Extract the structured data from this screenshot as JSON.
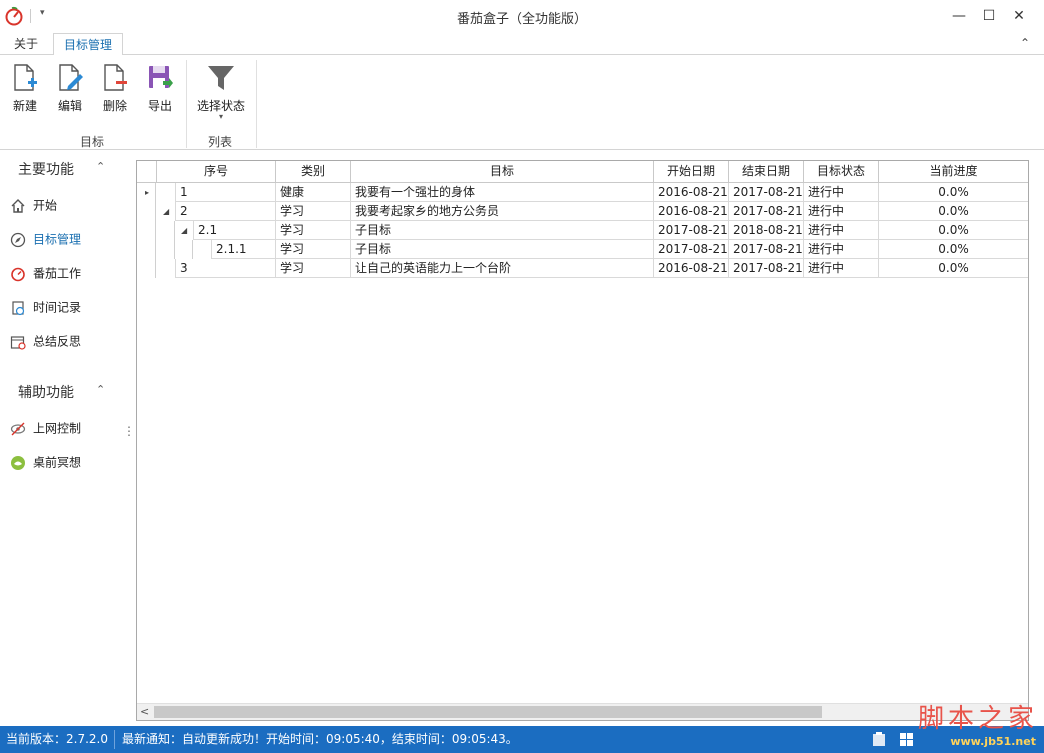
{
  "window": {
    "title": "番茄盒子（全功能版）",
    "minimize_glyph": "—",
    "maximize_glyph": "☐",
    "close_glyph": "✕",
    "quick_access_glyph": "▾"
  },
  "tabs": [
    {
      "label": "关于"
    },
    {
      "label": "目标管理"
    }
  ],
  "ribbon": {
    "collapse_glyph": "⌃",
    "buttons": [
      {
        "label": "新建",
        "icon": "new-doc-icon"
      },
      {
        "label": "编辑",
        "icon": "edit-icon"
      },
      {
        "label": "删除",
        "icon": "delete-doc-icon"
      },
      {
        "label": "导出",
        "icon": "export-icon"
      },
      {
        "label": "选择状态",
        "icon": "filter-icon"
      }
    ],
    "dropdown_glyph": "▾",
    "groups": [
      "目标",
      "列表"
    ]
  },
  "sidebar": {
    "sections": [
      {
        "title": "主要功能",
        "items": [
          "开始",
          "目标管理",
          "番茄工作",
          "时间记录",
          "总结反思"
        ]
      },
      {
        "title": "辅助功能",
        "items": [
          "上网控制",
          "桌前冥想"
        ]
      }
    ],
    "chevron_glyph": "⌃",
    "grip_glyph": "⋮"
  },
  "grid": {
    "columns": [
      "序号",
      "类别",
      "目标",
      "开始日期",
      "结束日期",
      "目标状态",
      "当前进度"
    ],
    "rows": [
      {
        "id": "1",
        "category": "健康",
        "goal": "我要有一个强壮的身体",
        "start": "2016-08-21",
        "end": "2017-08-21",
        "status": "进行中",
        "progress": "0.0%",
        "toggle": "▸"
      },
      {
        "id": "2",
        "category": "学习",
        "goal": "我要考起家乡的地方公务员",
        "start": "2016-08-21",
        "end": "2017-08-21",
        "status": "进行中",
        "progress": "0.0%",
        "toggle": "◢"
      },
      {
        "id": "2.1",
        "category": "学习",
        "goal": "子目标",
        "start": "2017-08-21",
        "end": "2018-08-21",
        "status": "进行中",
        "progress": "0.0%",
        "toggle": "◢"
      },
      {
        "id": "2.1.1",
        "category": "学习",
        "goal": "子目标",
        "start": "2017-08-21",
        "end": "2017-08-21",
        "status": "进行中",
        "progress": "0.0%",
        "toggle": ""
      },
      {
        "id": "3",
        "category": "学习",
        "goal": "让自己的英语能力上一个台阶",
        "start": "2016-08-21",
        "end": "2017-08-21",
        "status": "进行中",
        "progress": "0.0%",
        "toggle": ""
      }
    ],
    "scroll_left_glyph": "<"
  },
  "status": {
    "version": "当前版本：2.7.2.0",
    "notice": "最新通知：自动更新成功！开始时间：09:05:40，结束时间：09:05:43。"
  },
  "watermark": {
    "text": "脚本之家",
    "url": "www.jb51.net"
  },
  "colors": {
    "accent": "#1a6fb0",
    "statusbar": "#1b6dc1",
    "watermark": "#e8534a"
  }
}
